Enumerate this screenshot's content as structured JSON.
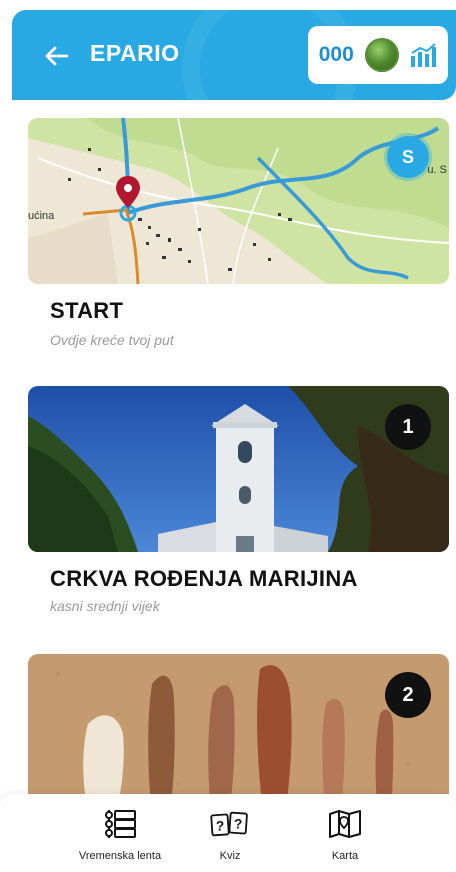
{
  "header": {
    "title": "EPARIO",
    "back_icon": "arrow-left-icon",
    "score": "000",
    "coin_icon": "green-coin-icon",
    "stats_icon": "bar-chart-icon",
    "accent_color": "#29a9e3"
  },
  "cards": [
    {
      "title": "START",
      "subtitle": "Ovdje kreće tvoj put",
      "badge": "S",
      "map_label_left": "ućina",
      "map_label_right": "u. S"
    },
    {
      "title": "CRKVA ROĐENJA MARIJINA",
      "subtitle": "kasni srednji vijek",
      "badge": "1"
    },
    {
      "title": "",
      "subtitle": "",
      "badge": "2"
    }
  ],
  "nav": {
    "items": [
      {
        "label": "Vremenska lenta",
        "icon": "timeline-icon"
      },
      {
        "label": "Kviz",
        "icon": "quiz-icon"
      },
      {
        "label": "Karta",
        "icon": "map-icon"
      }
    ]
  }
}
